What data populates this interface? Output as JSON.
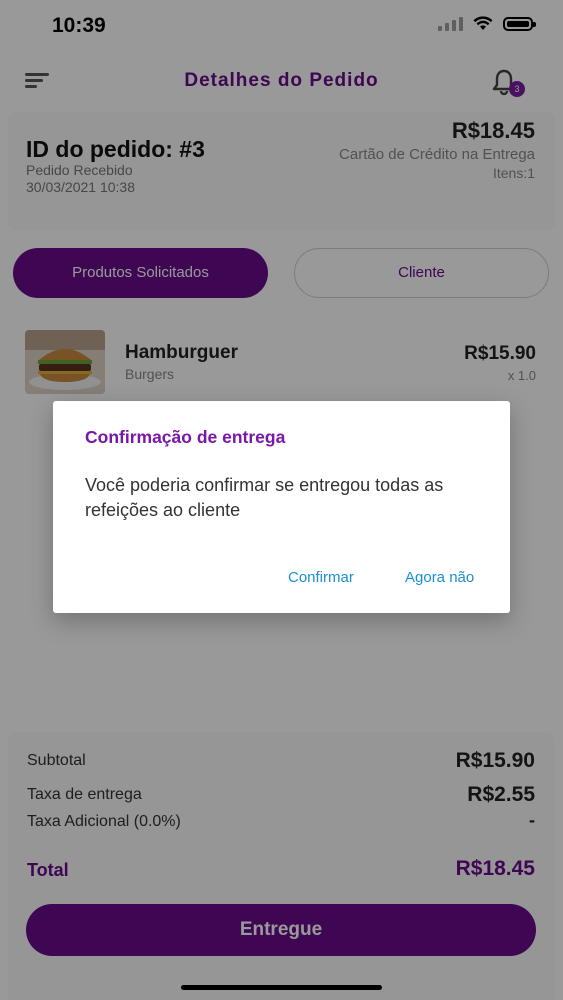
{
  "status_bar": {
    "time": "10:39"
  },
  "header": {
    "title": "Detalhes do Pedido",
    "notification_count": "3"
  },
  "order": {
    "id_label": "ID do pedido: #3",
    "status": "Pedido Recebido",
    "date": "30/03/2021 10:38",
    "total": "R$18.45",
    "payment_method": "Cartão de Crédito na Entrega",
    "items": "Itens:1"
  },
  "tabs": [
    {
      "label": "Produtos Solicitados",
      "active": true
    },
    {
      "label": "Cliente",
      "active": false
    }
  ],
  "products": [
    {
      "name": "Hamburguer",
      "category": "Burgers",
      "price": "R$15.90",
      "quantity": "x 1.0"
    }
  ],
  "summary": {
    "subtotal_label": "Subtotal",
    "subtotal_value": "R$15.90",
    "delivery_fee_label": "Taxa de entrega",
    "delivery_fee_value": "R$2.55",
    "extra_fee_label": "Taxa Adicional (0.0%)",
    "extra_fee_value": "-",
    "total_label": "Total",
    "total_value": "R$18.45"
  },
  "deliver_button": "Entregue",
  "dialog": {
    "title": "Confirmação de entrega",
    "message": "Você poderia confirmar se entregou todas as refeições ao cliente",
    "confirm_label": "Confirmar",
    "cancel_label": "Agora não"
  },
  "colors": {
    "accent": "#6a0b8a",
    "dialog_button": "#1a8fd1"
  }
}
